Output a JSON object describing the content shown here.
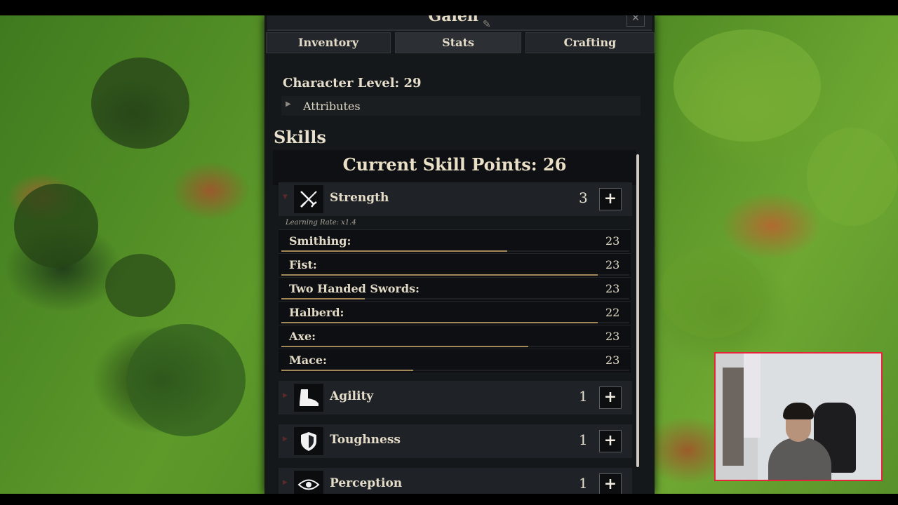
{
  "panel": {
    "character_name": "Galen",
    "tabs": [
      {
        "label": "Inventory",
        "active": false
      },
      {
        "label": "Stats",
        "active": true
      },
      {
        "label": "Crafting",
        "active": false
      }
    ],
    "character_level": "Character Level: 29",
    "attributes_label": "Attributes",
    "skills_heading": "Skills",
    "skill_points": "Current Skill Points: 26",
    "categories": [
      {
        "label": "Strength",
        "value": "3",
        "icon": "sword-crossed-icon",
        "expanded": true,
        "learning_rate": "Learning Rate: x1.4",
        "skills": [
          {
            "name": "Smithing:",
            "value": "23",
            "progress": 0.65
          },
          {
            "name": "Fist:",
            "value": "23",
            "progress": 0.91
          },
          {
            "name": "Two Handed Swords:",
            "value": "23",
            "progress": 0.24
          },
          {
            "name": "Halberd:",
            "value": "22",
            "progress": 0.91
          },
          {
            "name": "Axe:",
            "value": "23",
            "progress": 0.71
          },
          {
            "name": "Mace:",
            "value": "23",
            "progress": 0.38
          }
        ]
      },
      {
        "label": "Agility",
        "value": "1",
        "icon": "boot-icon",
        "expanded": false
      },
      {
        "label": "Toughness",
        "value": "1",
        "icon": "shield-icon",
        "expanded": false
      },
      {
        "label": "Perception",
        "value": "1",
        "icon": "eye-icon",
        "expanded": false
      }
    ],
    "plus_label": "+"
  },
  "colors": {
    "panel_bg": "#15181b",
    "progress_fill": "#a3895a",
    "webcam_border": "#e8243a"
  }
}
